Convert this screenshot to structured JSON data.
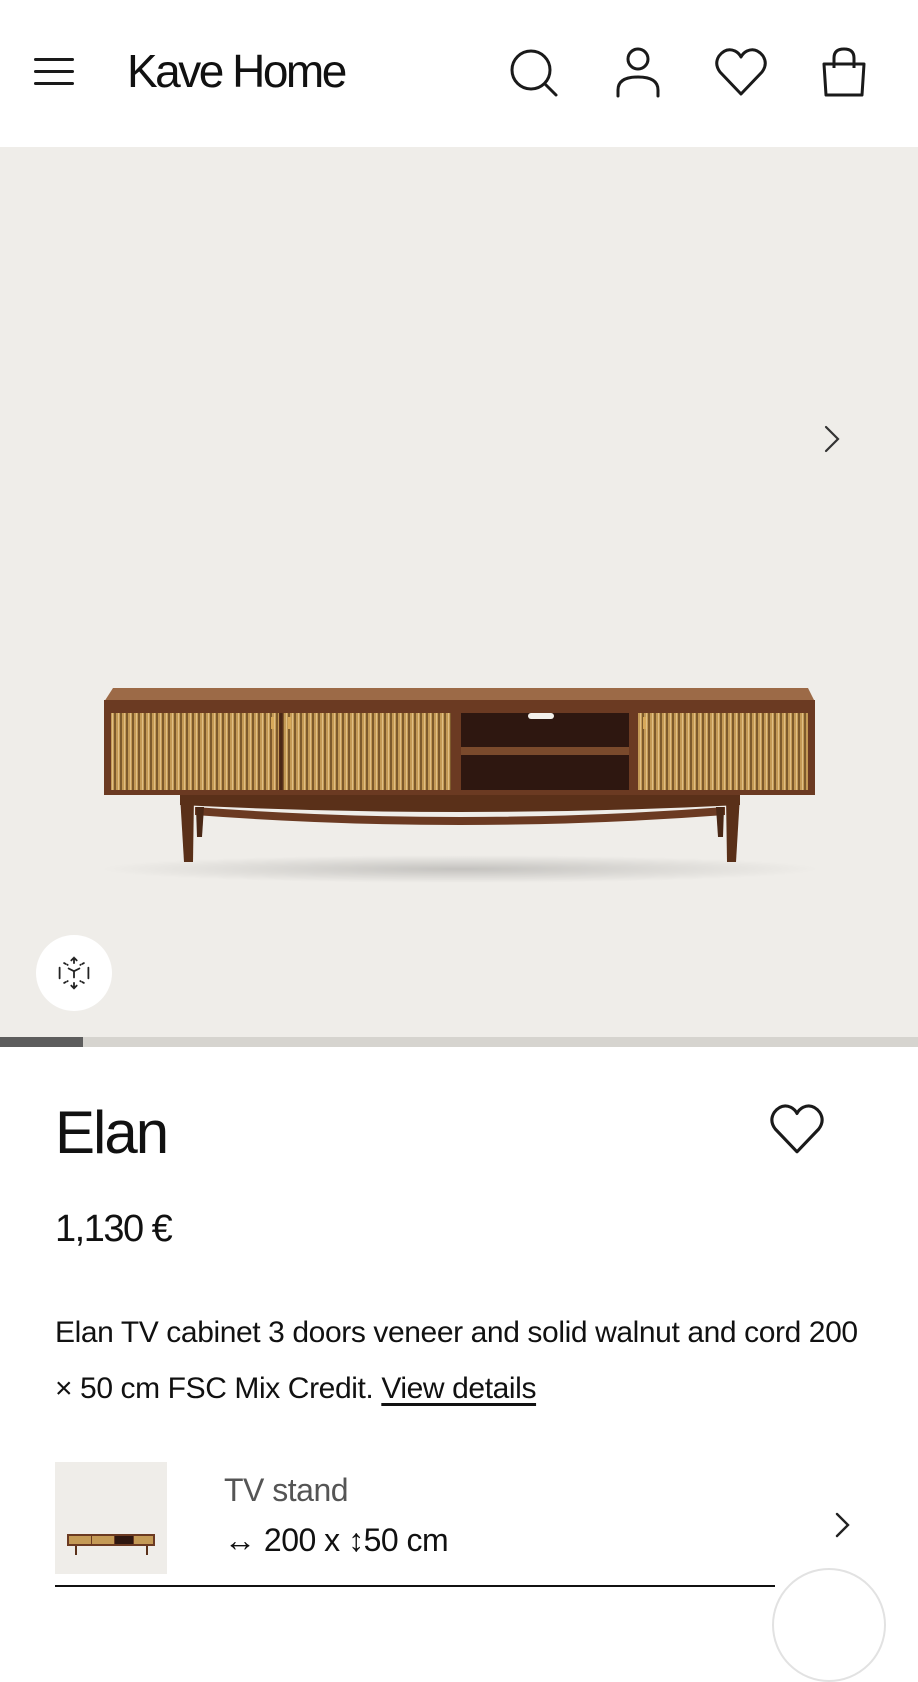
{
  "header": {
    "logo": "Kave Home",
    "icons": [
      "menu-icon",
      "search-icon",
      "account-icon",
      "heart-icon",
      "bag-icon"
    ]
  },
  "gallery": {
    "progress_fraction": 0.09,
    "background": "#efede9"
  },
  "product": {
    "name": "Elan",
    "price": "1,130 €",
    "description": "Elan TV cabinet 3 doors veneer and solid walnut and cord 200 × 50 cm FSC Mix Credit.",
    "view_details": "View details"
  },
  "variant": {
    "name": "TV stand",
    "width": "200",
    "x": "x",
    "height": "50 cm",
    "width_arrow": "↔",
    "height_arrow": "↕"
  },
  "colors": {
    "text": "#111111",
    "walnut": "#7a4a2c",
    "cord": "#b9924f"
  }
}
